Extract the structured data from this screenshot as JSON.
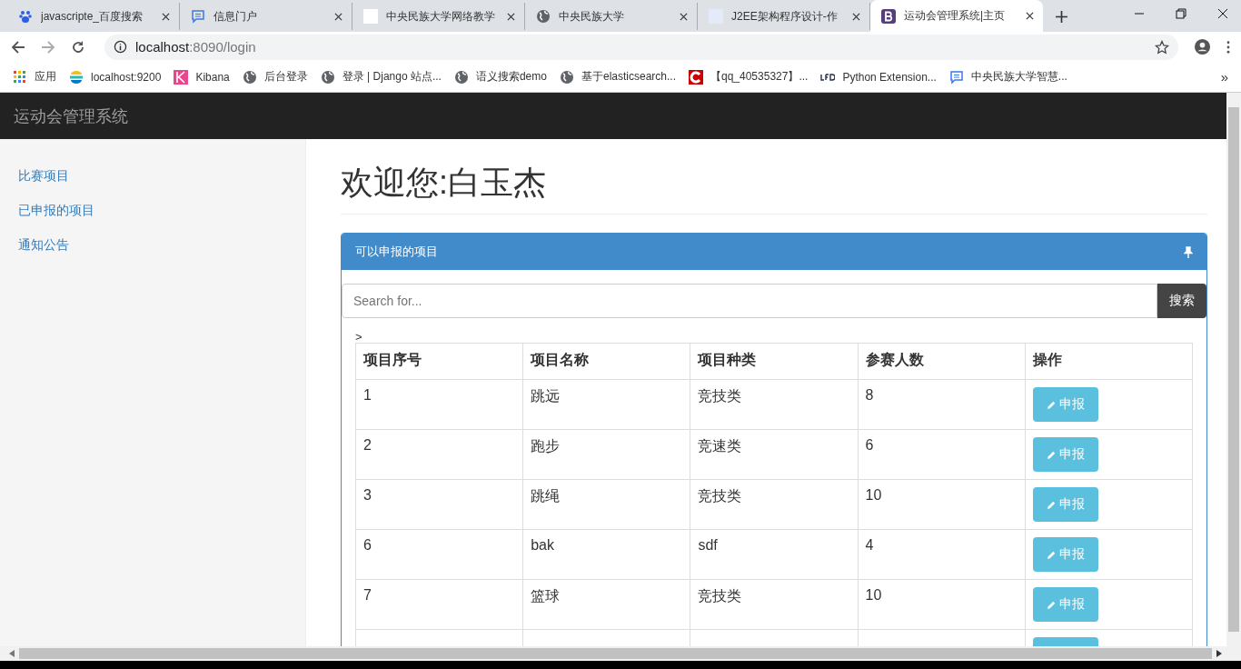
{
  "browser": {
    "tabs": [
      {
        "title": "javascripte_百度搜索",
        "selected": false
      },
      {
        "title": "信息门户",
        "selected": false
      },
      {
        "title": "中央民族大学网络教学",
        "selected": false
      },
      {
        "title": "中央民族大学",
        "selected": false
      },
      {
        "title": "J2EE架构程序设计-作",
        "selected": false
      },
      {
        "title": "运动会管理系统|主页",
        "selected": true
      }
    ],
    "address": {
      "host": "localhost",
      "rest": ":8090/login"
    },
    "bookmarks": [
      {
        "label": "应用"
      },
      {
        "label": "localhost:9200"
      },
      {
        "label": "Kibana"
      },
      {
        "label": "后台登录"
      },
      {
        "label": "登录 | Django 站点..."
      },
      {
        "label": "语义搜索demo"
      },
      {
        "label": "基于elasticsearch..."
      },
      {
        "label": "【qq_40535327】..."
      },
      {
        "label": "Python Extension..."
      },
      {
        "label": "中央民族大学智慧..."
      }
    ],
    "more": "»"
  },
  "navbar": {
    "brand": "运动会管理系统"
  },
  "sidebar": {
    "items": [
      {
        "label": "比赛项目"
      },
      {
        "label": "已申报的项目"
      },
      {
        "label": "通知公告"
      }
    ]
  },
  "heading": "欢迎您:白玉杰",
  "panel": {
    "title": "可以申报的项目",
    "search": {
      "placeholder": "Search for...",
      "button": "搜索"
    },
    "stray_text": ">",
    "table": {
      "columns": [
        "项目序号",
        "项目名称",
        "项目种类",
        "参赛人数",
        "操作"
      ],
      "rows": [
        {
          "cells": [
            "1",
            "跳远",
            "竞技类",
            "8"
          ],
          "action": "申报"
        },
        {
          "cells": [
            "2",
            "跑步",
            "竞速类",
            "6"
          ],
          "action": "申报"
        },
        {
          "cells": [
            "3",
            "跳绳",
            "竞技类",
            "10"
          ],
          "action": "申报"
        },
        {
          "cells": [
            "6",
            "bak",
            "sdf",
            "4"
          ],
          "action": "申报"
        },
        {
          "cells": [
            "7",
            "篮球",
            "竞技类",
            "10"
          ],
          "action": "申报"
        }
      ]
    }
  }
}
